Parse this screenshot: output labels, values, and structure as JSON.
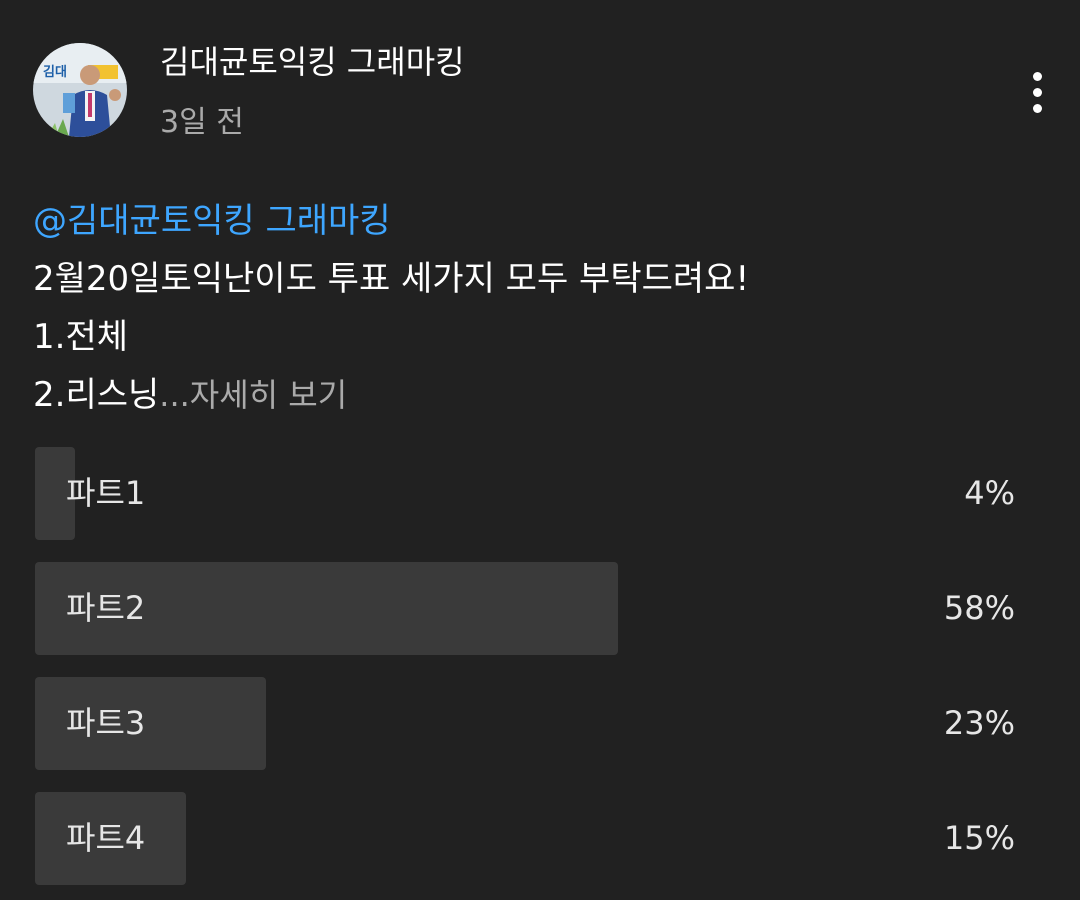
{
  "post": {
    "channel_name": "김대균토익킹 그래마킹",
    "time": "3일 전",
    "mention": "@김대균토익킹 그래마킹",
    "lines": [
      "2월20일토익난이도 투표 세가지 모두 부탁드려요!",
      "1.전체",
      "2.리스닝"
    ],
    "ellipsis": "...",
    "read_more": "자세히 보기"
  },
  "icons": {
    "more": "more-vertical-icon",
    "avatar": "channel-avatar-photo"
  },
  "avatar_logo": {
    "text": "김대"
  },
  "poll": {
    "options": [
      {
        "label": "파트1",
        "percent_text": "4%",
        "percent": 4
      },
      {
        "label": "파트2",
        "percent_text": "58%",
        "percent": 58
      },
      {
        "label": "파트3",
        "percent_text": "23%",
        "percent": 23
      },
      {
        "label": "파트4",
        "percent_text": "15%",
        "percent": 15
      }
    ]
  },
  "colors": {
    "background": "#212121",
    "text_primary": "#ffffff",
    "text_secondary": "#aaaaaa",
    "mention": "#3ea6ff",
    "poll_bar": "#3a3a3a"
  }
}
